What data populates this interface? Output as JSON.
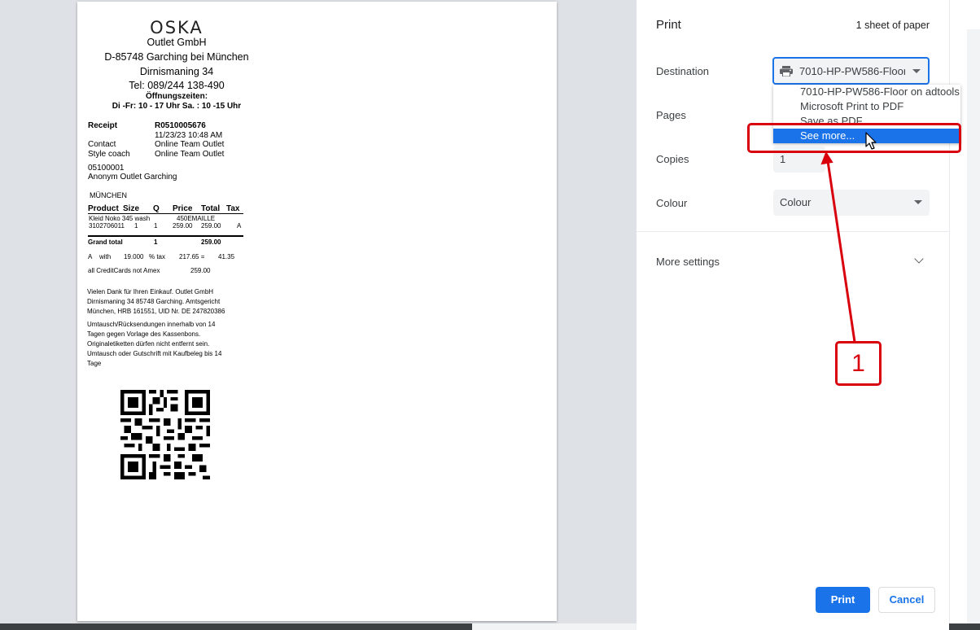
{
  "receipt": {
    "logo": "OSKA",
    "header_lines": [
      "Outlet GmbH",
      "D-85748 Garching bei München",
      "Dirnismaning 34",
      "Tel: 089/244 138-490"
    ],
    "hours_title": "Öffnungszeiten:",
    "hours": "Di -Fr: 10 - 17 Uhr Sa. : 10 -15 Uhr",
    "receipt_label": "Receipt",
    "receipt_no": "R0510005676",
    "datetime": "11/23/23 10:48 AM",
    "contact_label": "Contact",
    "contact_value": "Online Team Outlet",
    "coach_label": "Style coach",
    "coach_value": "Online Team Outlet",
    "customer_no": "05100001",
    "customer_name": "Anonym Outlet Garching",
    "city": "MÜNCHEN",
    "table_headers": [
      "Product",
      "Size",
      "Q",
      "Price",
      "Total",
      "Tax"
    ],
    "item_name": "Kleid Noko 345 wash",
    "item_color": "450EMAILLE",
    "item_row": [
      "3102706011",
      "1",
      "1",
      "259.00",
      "259.00",
      "A"
    ],
    "grand_total_label": "Grand total",
    "grand_total_qty": "1",
    "grand_total_value": "259.00",
    "tax_row": [
      "A",
      "with",
      "19.000",
      "% tax",
      "217.65 =",
      "41.35"
    ],
    "payment_label": "all CreditCards not Amex",
    "payment_value": "259.00",
    "footer1": [
      "Vielen Dank für Ihren Einkauf. Outlet GmbH",
      "Dirnismaning 34 85748 Garching. Amtsgericht",
      "München, HRB 161551, UID Nr. DE 247820386"
    ],
    "footer2": [
      "Umtausch/Rücksendungen innerhalb von 14",
      "Tagen gegen Vorlage des Kassenbons.",
      "Originaletiketten dürfen nicht entfernt sein.",
      "Umtausch oder Gutschrift mit Kaufbeleg bis 14",
      "Tage"
    ]
  },
  "panel": {
    "title": "Print",
    "sheets": "1 sheet of paper",
    "destination_label": "Destination",
    "destination_value": "7010-HP-PW586-Floor on adtools",
    "pages_label": "Pages",
    "copies_label": "Copies",
    "copies_value": "1",
    "colour_label": "Colour",
    "colour_value": "Colour",
    "more_settings_label": "More settings",
    "print_button": "Print",
    "cancel_button": "Cancel"
  },
  "dropdown": {
    "options": [
      "7010-HP-PW586-Floor on adtools",
      "Microsoft Print to PDF",
      "Save as PDF",
      "See more..."
    ],
    "selected_index": 3
  },
  "annotation": {
    "callout_number": "1",
    "color": "#d9000d"
  },
  "colors": {
    "accent": "#1a73e8",
    "preview_bg": "#dee1e6"
  }
}
